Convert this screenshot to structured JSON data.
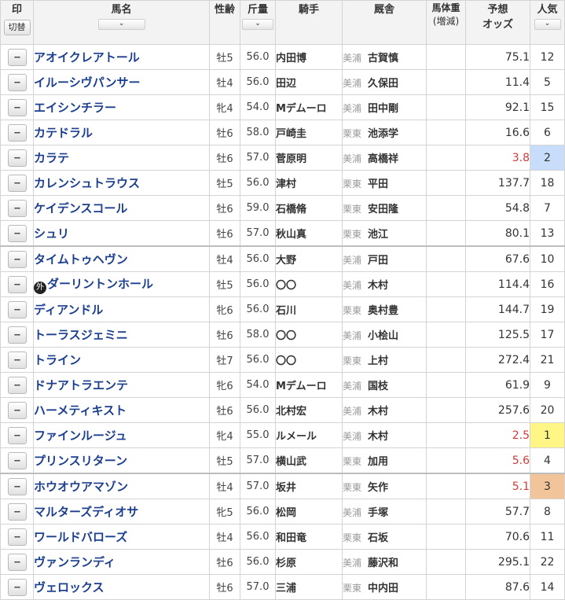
{
  "header": {
    "mark": "印",
    "toggle": "切替",
    "horse_name": "馬名",
    "sex_age": "性齢",
    "weight": "斤量",
    "jockey": "騎手",
    "stable": "厩舎",
    "body_weight": "馬体重",
    "body_weight_sub": "(増減)",
    "odds": "予想",
    "odds_sub": "オッズ",
    "popularity": "人気",
    "sort_icon": "chevron-down-icon",
    "sort_glyph": "⌄"
  },
  "mark_default": "--",
  "foreign_mark": "外",
  "highlight_colors": {
    "odds_hot": "#d33b3b",
    "pop1": "#fff685",
    "pop2": "#c7ddfa",
    "pop3": "#f2c49a"
  },
  "horses": [
    {
      "name": "アオイクレアトール",
      "sex_age": "牡5",
      "weight": "56.0",
      "jockey": "内田博",
      "region": "美浦",
      "trainer": "古賀慎",
      "odds": "75.1",
      "pop": "12"
    },
    {
      "name": "イルーシヴパンサー",
      "sex_age": "牡4",
      "weight": "56.0",
      "jockey": "田辺",
      "region": "美浦",
      "trainer": "久保田",
      "odds": "11.4",
      "pop": "5"
    },
    {
      "name": "エイシンチラー",
      "sex_age": "牝4",
      "weight": "54.0",
      "jockey": "Mデムーロ",
      "region": "美浦",
      "trainer": "田中剛",
      "odds": "92.1",
      "pop": "15"
    },
    {
      "name": "カテドラル",
      "sex_age": "牡6",
      "weight": "58.0",
      "jockey": "戸崎圭",
      "region": "栗東",
      "trainer": "池添学",
      "odds": "16.6",
      "pop": "6"
    },
    {
      "name": "カラテ",
      "sex_age": "牡6",
      "weight": "57.0",
      "jockey": "菅原明",
      "region": "美浦",
      "trainer": "高橋祥",
      "odds": "3.8",
      "pop": "2"
    },
    {
      "name": "カレンシュトラウス",
      "sex_age": "牡5",
      "weight": "56.0",
      "jockey": "津村",
      "region": "栗東",
      "trainer": "平田",
      "odds": "137.7",
      "pop": "18"
    },
    {
      "name": "ケイデンスコール",
      "sex_age": "牡6",
      "weight": "59.0",
      "jockey": "石橋脩",
      "region": "栗東",
      "trainer": "安田隆",
      "odds": "54.8",
      "pop": "7"
    },
    {
      "name": "シュリ",
      "sex_age": "牡6",
      "weight": "57.0",
      "jockey": "秋山真",
      "region": "栗東",
      "trainer": "池江",
      "odds": "80.1",
      "pop": "13"
    },
    {
      "name": "タイムトゥヘヴン",
      "sex_age": "牡4",
      "weight": "56.0",
      "jockey": "大野",
      "region": "美浦",
      "trainer": "戸田",
      "odds": "67.6",
      "pop": "10"
    },
    {
      "name": "ダーリントンホール",
      "foreign": true,
      "sex_age": "牡5",
      "weight": "56.0",
      "jockey": "〇〇",
      "region": "美浦",
      "trainer": "木村",
      "odds": "114.4",
      "pop": "16"
    },
    {
      "name": "ディアンドル",
      "sex_age": "牝6",
      "weight": "56.0",
      "jockey": "石川",
      "region": "栗東",
      "trainer": "奥村豊",
      "odds": "144.7",
      "pop": "19"
    },
    {
      "name": "トーラスジェミニ",
      "sex_age": "牡6",
      "weight": "58.0",
      "jockey": "〇〇",
      "region": "美浦",
      "trainer": "小桧山",
      "odds": "125.5",
      "pop": "17"
    },
    {
      "name": "トライン",
      "sex_age": "牡7",
      "weight": "56.0",
      "jockey": "〇〇",
      "region": "栗東",
      "trainer": "上村",
      "odds": "272.4",
      "pop": "21"
    },
    {
      "name": "ドナアトラエンテ",
      "sex_age": "牝6",
      "weight": "54.0",
      "jockey": "Mデムーロ",
      "region": "美浦",
      "trainer": "国枝",
      "odds": "61.9",
      "pop": "9"
    },
    {
      "name": "ハーメティキスト",
      "sex_age": "牡6",
      "weight": "56.0",
      "jockey": "北村宏",
      "region": "美浦",
      "trainer": "木村",
      "odds": "257.6",
      "pop": "20"
    },
    {
      "name": "ファインルージュ",
      "sex_age": "牝4",
      "weight": "55.0",
      "jockey": "ルメール",
      "region": "美浦",
      "trainer": "木村",
      "odds": "2.5",
      "pop": "1"
    },
    {
      "name": "プリンスリターン",
      "sex_age": "牡5",
      "weight": "57.0",
      "jockey": "横山武",
      "region": "栗東",
      "trainer": "加用",
      "odds": "5.6",
      "pop": "4"
    },
    {
      "name": "ホウオウアマゾン",
      "sex_age": "牡4",
      "weight": "57.0",
      "jockey": "坂井",
      "region": "栗東",
      "trainer": "矢作",
      "odds": "5.1",
      "pop": "3"
    },
    {
      "name": "マルターズディオサ",
      "sex_age": "牝5",
      "weight": "56.0",
      "jockey": "松岡",
      "region": "美浦",
      "trainer": "手塚",
      "odds": "57.7",
      "pop": "8"
    },
    {
      "name": "ワールドバローズ",
      "sex_age": "牡4",
      "weight": "56.0",
      "jockey": "和田竜",
      "region": "栗東",
      "trainer": "石坂",
      "odds": "70.6",
      "pop": "11"
    },
    {
      "name": "ヴァンランディ",
      "sex_age": "牡6",
      "weight": "56.0",
      "jockey": "杉原",
      "region": "美浦",
      "trainer": "藤沢和",
      "odds": "295.1",
      "pop": "22"
    },
    {
      "name": "ヴェロックス",
      "sex_age": "牡6",
      "weight": "57.0",
      "jockey": "三浦",
      "region": "栗東",
      "trainer": "中内田",
      "odds": "87.6",
      "pop": "14"
    }
  ]
}
